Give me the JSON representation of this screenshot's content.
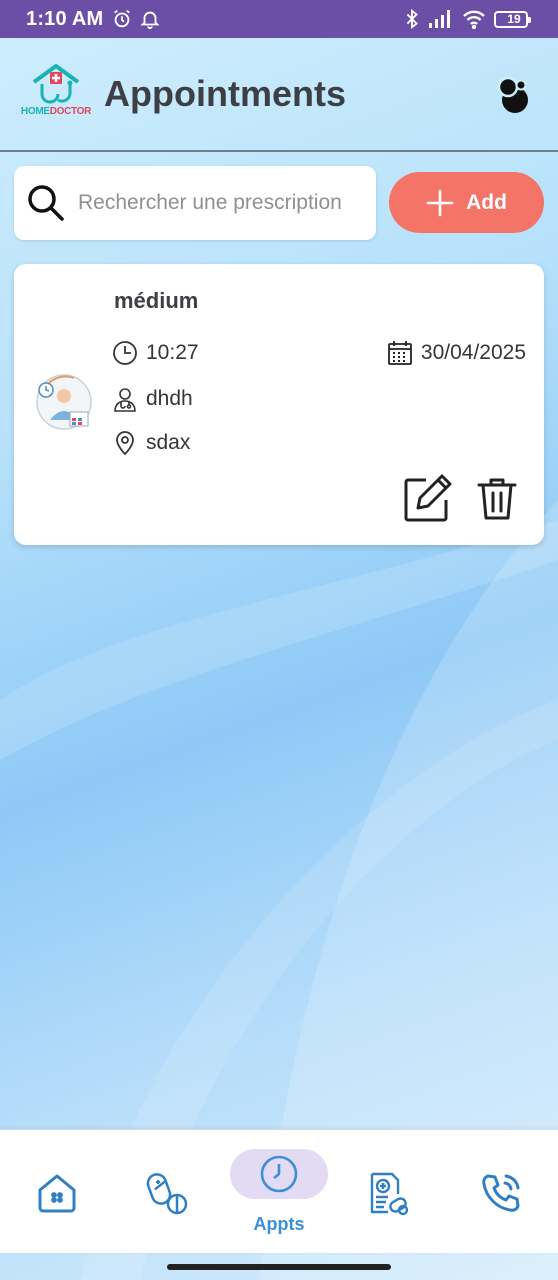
{
  "status_bar": {
    "time": "1:10 AM",
    "battery": "19",
    "icons": [
      "alarm-icon",
      "bell-icon",
      "bluetooth-icon",
      "signal-icon",
      "wifi-icon",
      "battery-icon"
    ]
  },
  "header": {
    "logo_text_home": "HOME",
    "logo_text_doctor": "DOCTOR",
    "title": "Appointments",
    "profile_icon": "profile-switch-icon"
  },
  "search": {
    "placeholder": "Rechercher une prescription",
    "value": ""
  },
  "add_button": {
    "label": "Add"
  },
  "appointments": [
    {
      "title": "médium",
      "time": "10:27",
      "date": "30/04/2025",
      "doctor": "dhdh",
      "location": "sdax"
    }
  ],
  "bottom_nav": {
    "items": [
      {
        "name": "home",
        "icon": "home-icon",
        "active": false
      },
      {
        "name": "medications",
        "icon": "pills-icon",
        "active": false
      },
      {
        "name": "appointments",
        "icon": "clock-icon",
        "label": "Appts",
        "active": true
      },
      {
        "name": "reports",
        "icon": "medical-report-icon",
        "active": false
      },
      {
        "name": "calls",
        "icon": "phone-call-icon",
        "active": false
      }
    ]
  },
  "colors": {
    "status_bar": "#6b4fa6",
    "accent_button": "#f47468",
    "nav_active": "#3a8fd6",
    "nav_pill": "#e3dbf4"
  }
}
